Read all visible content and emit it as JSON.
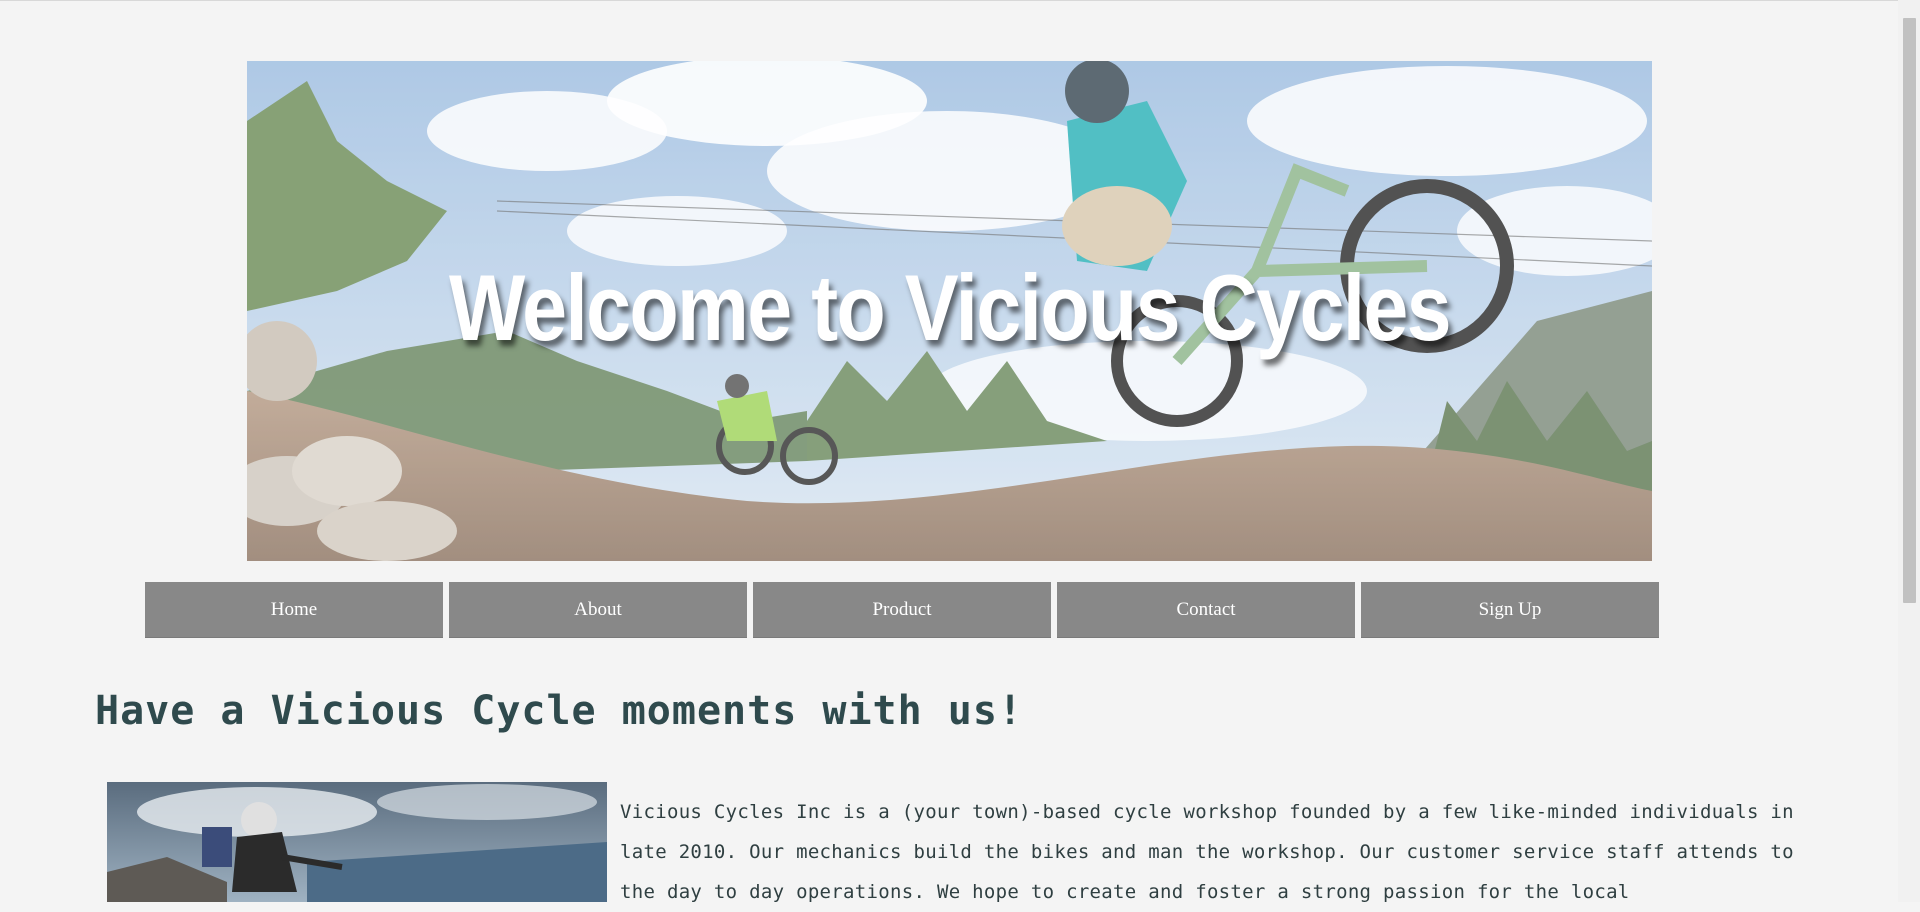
{
  "hero": {
    "title": "Welcome to Vicious Cycles"
  },
  "nav": {
    "items": [
      {
        "label": "Home"
      },
      {
        "label": "About"
      },
      {
        "label": "Product"
      },
      {
        "label": "Contact"
      },
      {
        "label": "Sign Up"
      }
    ]
  },
  "main": {
    "headline": "Have a Vicious Cycle moments with us!",
    "intro": "Vicious Cycles Inc is a (your town)-based cycle workshop founded by a few like-minded individuals in late 2010. Our mechanics build the bikes and man the workshop. Our customer service staff attends to the day to day operations. We hope to create and foster a strong passion for the local"
  },
  "colors": {
    "background": "#f4f4f4",
    "nav_button": "#888888",
    "headline": "#2f4a4d"
  }
}
